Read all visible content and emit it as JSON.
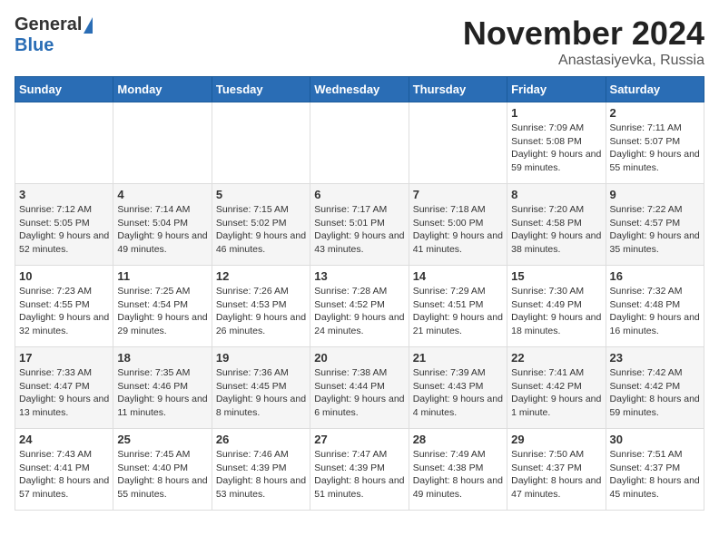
{
  "logo": {
    "general": "General",
    "blue": "Blue"
  },
  "title": "November 2024",
  "subtitle": "Anastasiyevka, Russia",
  "days_of_week": [
    "Sunday",
    "Monday",
    "Tuesday",
    "Wednesday",
    "Thursday",
    "Friday",
    "Saturday"
  ],
  "weeks": [
    [
      {
        "day": "",
        "info": ""
      },
      {
        "day": "",
        "info": ""
      },
      {
        "day": "",
        "info": ""
      },
      {
        "day": "",
        "info": ""
      },
      {
        "day": "",
        "info": ""
      },
      {
        "day": "1",
        "info": "Sunrise: 7:09 AM\nSunset: 5:08 PM\nDaylight: 9 hours and 59 minutes."
      },
      {
        "day": "2",
        "info": "Sunrise: 7:11 AM\nSunset: 5:07 PM\nDaylight: 9 hours and 55 minutes."
      }
    ],
    [
      {
        "day": "3",
        "info": "Sunrise: 7:12 AM\nSunset: 5:05 PM\nDaylight: 9 hours and 52 minutes."
      },
      {
        "day": "4",
        "info": "Sunrise: 7:14 AM\nSunset: 5:04 PM\nDaylight: 9 hours and 49 minutes."
      },
      {
        "day": "5",
        "info": "Sunrise: 7:15 AM\nSunset: 5:02 PM\nDaylight: 9 hours and 46 minutes."
      },
      {
        "day": "6",
        "info": "Sunrise: 7:17 AM\nSunset: 5:01 PM\nDaylight: 9 hours and 43 minutes."
      },
      {
        "day": "7",
        "info": "Sunrise: 7:18 AM\nSunset: 5:00 PM\nDaylight: 9 hours and 41 minutes."
      },
      {
        "day": "8",
        "info": "Sunrise: 7:20 AM\nSunset: 4:58 PM\nDaylight: 9 hours and 38 minutes."
      },
      {
        "day": "9",
        "info": "Sunrise: 7:22 AM\nSunset: 4:57 PM\nDaylight: 9 hours and 35 minutes."
      }
    ],
    [
      {
        "day": "10",
        "info": "Sunrise: 7:23 AM\nSunset: 4:55 PM\nDaylight: 9 hours and 32 minutes."
      },
      {
        "day": "11",
        "info": "Sunrise: 7:25 AM\nSunset: 4:54 PM\nDaylight: 9 hours and 29 minutes."
      },
      {
        "day": "12",
        "info": "Sunrise: 7:26 AM\nSunset: 4:53 PM\nDaylight: 9 hours and 26 minutes."
      },
      {
        "day": "13",
        "info": "Sunrise: 7:28 AM\nSunset: 4:52 PM\nDaylight: 9 hours and 24 minutes."
      },
      {
        "day": "14",
        "info": "Sunrise: 7:29 AM\nSunset: 4:51 PM\nDaylight: 9 hours and 21 minutes."
      },
      {
        "day": "15",
        "info": "Sunrise: 7:30 AM\nSunset: 4:49 PM\nDaylight: 9 hours and 18 minutes."
      },
      {
        "day": "16",
        "info": "Sunrise: 7:32 AM\nSunset: 4:48 PM\nDaylight: 9 hours and 16 minutes."
      }
    ],
    [
      {
        "day": "17",
        "info": "Sunrise: 7:33 AM\nSunset: 4:47 PM\nDaylight: 9 hours and 13 minutes."
      },
      {
        "day": "18",
        "info": "Sunrise: 7:35 AM\nSunset: 4:46 PM\nDaylight: 9 hours and 11 minutes."
      },
      {
        "day": "19",
        "info": "Sunrise: 7:36 AM\nSunset: 4:45 PM\nDaylight: 9 hours and 8 minutes."
      },
      {
        "day": "20",
        "info": "Sunrise: 7:38 AM\nSunset: 4:44 PM\nDaylight: 9 hours and 6 minutes."
      },
      {
        "day": "21",
        "info": "Sunrise: 7:39 AM\nSunset: 4:43 PM\nDaylight: 9 hours and 4 minutes."
      },
      {
        "day": "22",
        "info": "Sunrise: 7:41 AM\nSunset: 4:42 PM\nDaylight: 9 hours and 1 minute."
      },
      {
        "day": "23",
        "info": "Sunrise: 7:42 AM\nSunset: 4:42 PM\nDaylight: 8 hours and 59 minutes."
      }
    ],
    [
      {
        "day": "24",
        "info": "Sunrise: 7:43 AM\nSunset: 4:41 PM\nDaylight: 8 hours and 57 minutes."
      },
      {
        "day": "25",
        "info": "Sunrise: 7:45 AM\nSunset: 4:40 PM\nDaylight: 8 hours and 55 minutes."
      },
      {
        "day": "26",
        "info": "Sunrise: 7:46 AM\nSunset: 4:39 PM\nDaylight: 8 hours and 53 minutes."
      },
      {
        "day": "27",
        "info": "Sunrise: 7:47 AM\nSunset: 4:39 PM\nDaylight: 8 hours and 51 minutes."
      },
      {
        "day": "28",
        "info": "Sunrise: 7:49 AM\nSunset: 4:38 PM\nDaylight: 8 hours and 49 minutes."
      },
      {
        "day": "29",
        "info": "Sunrise: 7:50 AM\nSunset: 4:37 PM\nDaylight: 8 hours and 47 minutes."
      },
      {
        "day": "30",
        "info": "Sunrise: 7:51 AM\nSunset: 4:37 PM\nDaylight: 8 hours and 45 minutes."
      }
    ]
  ]
}
